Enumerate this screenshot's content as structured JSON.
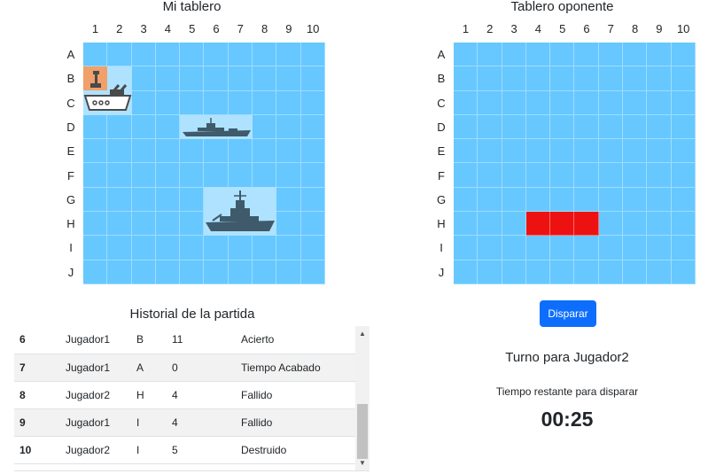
{
  "my_board": {
    "title": "Mi tablero",
    "columns": [
      "1",
      "2",
      "3",
      "4",
      "5",
      "6",
      "7",
      "8",
      "9",
      "10"
    ],
    "rows": [
      "A",
      "B",
      "C",
      "D",
      "E",
      "F",
      "G",
      "H",
      "I",
      "J"
    ],
    "ships": [
      {
        "name": "submarine-ship-icon",
        "start": "B1",
        "end": "C2",
        "highlight_color": "#f0a06a"
      },
      {
        "name": "frigate-ship-icon",
        "start": "D5",
        "end": "D7"
      },
      {
        "name": "destroyer-ship-icon",
        "start": "G6",
        "end": "H8"
      }
    ]
  },
  "opponent_board": {
    "title": "Tablero oponente",
    "columns": [
      "1",
      "2",
      "3",
      "4",
      "5",
      "6",
      "7",
      "8",
      "9",
      "10"
    ],
    "rows": [
      "A",
      "B",
      "C",
      "D",
      "E",
      "F",
      "G",
      "H",
      "I",
      "J"
    ],
    "hits": [
      "H4",
      "H5",
      "H6"
    ],
    "hit_color": "#ee1111"
  },
  "fire_button": {
    "label": "Disparar"
  },
  "turn_text": "Turno para Jugador2",
  "timer": {
    "label": "Tiempo restante para disparar",
    "value": "00:25"
  },
  "history": {
    "title": "Historial de la partida",
    "rows": [
      [
        "6",
        "Jugador1",
        "B",
        "11",
        "Acierto"
      ],
      [
        "7",
        "Jugador1",
        "A",
        "0",
        "Tiempo Acabado"
      ],
      [
        "8",
        "Jugador2",
        "H",
        "4",
        "Fallido"
      ],
      [
        "9",
        "Jugador1",
        "I",
        "4",
        "Fallido"
      ],
      [
        "10",
        "Jugador2",
        "I",
        "5",
        "Destruido"
      ]
    ]
  },
  "colors": {
    "water": "#66c8ff",
    "primary_button": "#0d6efd"
  }
}
